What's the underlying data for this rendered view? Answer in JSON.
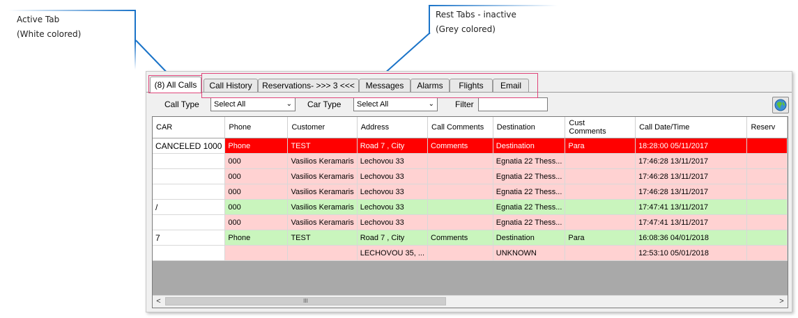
{
  "annotations": {
    "active": {
      "line1": "Active Tab",
      "line2": "(White colored)"
    },
    "rest": {
      "line1": "Rest Tabs - inactive",
      "line2": "(Grey colored)"
    }
  },
  "tabs": [
    {
      "label": "(8) All Calls",
      "active": true
    },
    {
      "label": "Call History",
      "active": false
    },
    {
      "label": "Reservations- >>> 3 <<<",
      "active": false
    },
    {
      "label": "Messages",
      "active": false
    },
    {
      "label": "Alarms",
      "active": false
    },
    {
      "label": "Flights",
      "active": false
    },
    {
      "label": "Email",
      "active": false
    }
  ],
  "filters": {
    "call_type_label": "Call Type",
    "call_type_value": "Select All",
    "car_type_label": "Car Type",
    "car_type_value": "Select All",
    "filter_label": "Filter",
    "filter_value": ""
  },
  "icons": {
    "refresh": "globe-icon",
    "dropdown": "chevron-down-icon"
  },
  "colors": {
    "canceled": "#ff0000",
    "pending": "#ffd2d2",
    "assigned": "#c9f5bd"
  },
  "table": {
    "columns": [
      "CAR",
      "Phone",
      "Customer",
      "Address",
      "Call Comments",
      "Destination",
      "Cust Comments",
      "Call Date/Time",
      "Reserv"
    ],
    "rows": [
      {
        "status": "red",
        "cells": [
          "CANCELED 1000",
          "Phone",
          "TEST",
          "Road 7 , City",
          "Comments",
          "Destination",
          "Para",
          "18:28:00 05/11/2017",
          ""
        ]
      },
      {
        "status": "pink",
        "cells": [
          "",
          "000",
          "Vasilios Keramaris",
          "Lechovou 33",
          "",
          "Egnatia 22 Thess...",
          "",
          "17:46:28 13/11/2017",
          ""
        ]
      },
      {
        "status": "pink",
        "cells": [
          "",
          "000",
          "Vasilios Keramaris",
          "Lechovou 33",
          "",
          "Egnatia 22 Thess...",
          "",
          "17:46:28 13/11/2017",
          ""
        ]
      },
      {
        "status": "pink",
        "cells": [
          "",
          "000",
          "Vasilios Keramaris",
          "Lechovou 33",
          "",
          "Egnatia 22 Thess...",
          "",
          "17:46:28 13/11/2017",
          ""
        ]
      },
      {
        "status": "green",
        "cells": [
          "/",
          "000",
          "Vasilios Keramaris",
          "Lechovou 33",
          "",
          "Egnatia 22 Thess...",
          "",
          "17:47:41 13/11/2017",
          ""
        ]
      },
      {
        "status": "pink",
        "cells": [
          "",
          "000",
          "Vasilios Keramaris",
          "Lechovou 33",
          "",
          "Egnatia 22 Thess...",
          "",
          "17:47:41 13/11/2017",
          ""
        ]
      },
      {
        "status": "green",
        "cells": [
          "7",
          "Phone",
          "TEST",
          "Road 7 , City",
          "Comments",
          "Destination",
          "Para",
          "16:08:36 04/01/2018",
          ""
        ]
      },
      {
        "status": "pink",
        "cells": [
          "",
          "",
          "",
          "LECHOVOU 35, ...",
          "",
          "UNKNOWN",
          "",
          "12:53:10 05/01/2018",
          ""
        ]
      }
    ]
  },
  "scrollbar": {
    "left": "<",
    "right": ">",
    "grip": "III"
  }
}
